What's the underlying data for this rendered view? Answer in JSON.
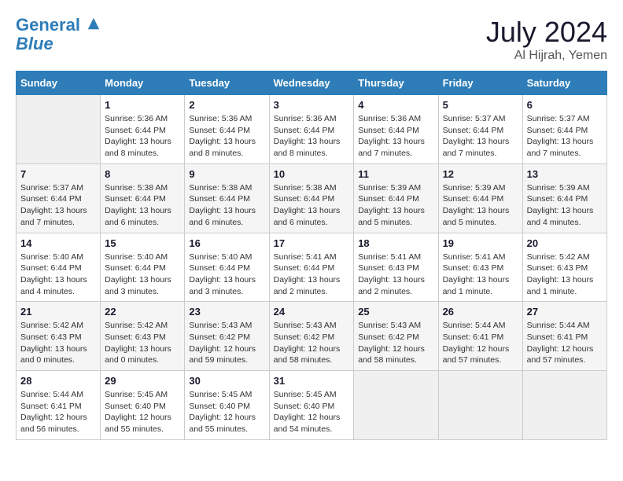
{
  "header": {
    "logo_line1": "General",
    "logo_line2": "Blue",
    "month": "July 2024",
    "location": "Al Hijrah, Yemen"
  },
  "days_of_week": [
    "Sunday",
    "Monday",
    "Tuesday",
    "Wednesday",
    "Thursday",
    "Friday",
    "Saturday"
  ],
  "weeks": [
    [
      {
        "day": "",
        "sunrise": "",
        "sunset": "",
        "daylight": ""
      },
      {
        "day": "1",
        "sunrise": "Sunrise: 5:36 AM",
        "sunset": "Sunset: 6:44 PM",
        "daylight": "Daylight: 13 hours and 8 minutes."
      },
      {
        "day": "2",
        "sunrise": "Sunrise: 5:36 AM",
        "sunset": "Sunset: 6:44 PM",
        "daylight": "Daylight: 13 hours and 8 minutes."
      },
      {
        "day": "3",
        "sunrise": "Sunrise: 5:36 AM",
        "sunset": "Sunset: 6:44 PM",
        "daylight": "Daylight: 13 hours and 8 minutes."
      },
      {
        "day": "4",
        "sunrise": "Sunrise: 5:36 AM",
        "sunset": "Sunset: 6:44 PM",
        "daylight": "Daylight: 13 hours and 7 minutes."
      },
      {
        "day": "5",
        "sunrise": "Sunrise: 5:37 AM",
        "sunset": "Sunset: 6:44 PM",
        "daylight": "Daylight: 13 hours and 7 minutes."
      },
      {
        "day": "6",
        "sunrise": "Sunrise: 5:37 AM",
        "sunset": "Sunset: 6:44 PM",
        "daylight": "Daylight: 13 hours and 7 minutes."
      }
    ],
    [
      {
        "day": "7",
        "sunrise": "Sunrise: 5:37 AM",
        "sunset": "Sunset: 6:44 PM",
        "daylight": "Daylight: 13 hours and 7 minutes."
      },
      {
        "day": "8",
        "sunrise": "Sunrise: 5:38 AM",
        "sunset": "Sunset: 6:44 PM",
        "daylight": "Daylight: 13 hours and 6 minutes."
      },
      {
        "day": "9",
        "sunrise": "Sunrise: 5:38 AM",
        "sunset": "Sunset: 6:44 PM",
        "daylight": "Daylight: 13 hours and 6 minutes."
      },
      {
        "day": "10",
        "sunrise": "Sunrise: 5:38 AM",
        "sunset": "Sunset: 6:44 PM",
        "daylight": "Daylight: 13 hours and 6 minutes."
      },
      {
        "day": "11",
        "sunrise": "Sunrise: 5:39 AM",
        "sunset": "Sunset: 6:44 PM",
        "daylight": "Daylight: 13 hours and 5 minutes."
      },
      {
        "day": "12",
        "sunrise": "Sunrise: 5:39 AM",
        "sunset": "Sunset: 6:44 PM",
        "daylight": "Daylight: 13 hours and 5 minutes."
      },
      {
        "day": "13",
        "sunrise": "Sunrise: 5:39 AM",
        "sunset": "Sunset: 6:44 PM",
        "daylight": "Daylight: 13 hours and 4 minutes."
      }
    ],
    [
      {
        "day": "14",
        "sunrise": "Sunrise: 5:40 AM",
        "sunset": "Sunset: 6:44 PM",
        "daylight": "Daylight: 13 hours and 4 minutes."
      },
      {
        "day": "15",
        "sunrise": "Sunrise: 5:40 AM",
        "sunset": "Sunset: 6:44 PM",
        "daylight": "Daylight: 13 hours and 3 minutes."
      },
      {
        "day": "16",
        "sunrise": "Sunrise: 5:40 AM",
        "sunset": "Sunset: 6:44 PM",
        "daylight": "Daylight: 13 hours and 3 minutes."
      },
      {
        "day": "17",
        "sunrise": "Sunrise: 5:41 AM",
        "sunset": "Sunset: 6:44 PM",
        "daylight": "Daylight: 13 hours and 2 minutes."
      },
      {
        "day": "18",
        "sunrise": "Sunrise: 5:41 AM",
        "sunset": "Sunset: 6:43 PM",
        "daylight": "Daylight: 13 hours and 2 minutes."
      },
      {
        "day": "19",
        "sunrise": "Sunrise: 5:41 AM",
        "sunset": "Sunset: 6:43 PM",
        "daylight": "Daylight: 13 hours and 1 minute."
      },
      {
        "day": "20",
        "sunrise": "Sunrise: 5:42 AM",
        "sunset": "Sunset: 6:43 PM",
        "daylight": "Daylight: 13 hours and 1 minute."
      }
    ],
    [
      {
        "day": "21",
        "sunrise": "Sunrise: 5:42 AM",
        "sunset": "Sunset: 6:43 PM",
        "daylight": "Daylight: 13 hours and 0 minutes."
      },
      {
        "day": "22",
        "sunrise": "Sunrise: 5:42 AM",
        "sunset": "Sunset: 6:43 PM",
        "daylight": "Daylight: 13 hours and 0 minutes."
      },
      {
        "day": "23",
        "sunrise": "Sunrise: 5:43 AM",
        "sunset": "Sunset: 6:42 PM",
        "daylight": "Daylight: 12 hours and 59 minutes."
      },
      {
        "day": "24",
        "sunrise": "Sunrise: 5:43 AM",
        "sunset": "Sunset: 6:42 PM",
        "daylight": "Daylight: 12 hours and 58 minutes."
      },
      {
        "day": "25",
        "sunrise": "Sunrise: 5:43 AM",
        "sunset": "Sunset: 6:42 PM",
        "daylight": "Daylight: 12 hours and 58 minutes."
      },
      {
        "day": "26",
        "sunrise": "Sunrise: 5:44 AM",
        "sunset": "Sunset: 6:41 PM",
        "daylight": "Daylight: 12 hours and 57 minutes."
      },
      {
        "day": "27",
        "sunrise": "Sunrise: 5:44 AM",
        "sunset": "Sunset: 6:41 PM",
        "daylight": "Daylight: 12 hours and 57 minutes."
      }
    ],
    [
      {
        "day": "28",
        "sunrise": "Sunrise: 5:44 AM",
        "sunset": "Sunset: 6:41 PM",
        "daylight": "Daylight: 12 hours and 56 minutes."
      },
      {
        "day": "29",
        "sunrise": "Sunrise: 5:45 AM",
        "sunset": "Sunset: 6:40 PM",
        "daylight": "Daylight: 12 hours and 55 minutes."
      },
      {
        "day": "30",
        "sunrise": "Sunrise: 5:45 AM",
        "sunset": "Sunset: 6:40 PM",
        "daylight": "Daylight: 12 hours and 55 minutes."
      },
      {
        "day": "31",
        "sunrise": "Sunrise: 5:45 AM",
        "sunset": "Sunset: 6:40 PM",
        "daylight": "Daylight: 12 hours and 54 minutes."
      },
      {
        "day": "",
        "sunrise": "",
        "sunset": "",
        "daylight": ""
      },
      {
        "day": "",
        "sunrise": "",
        "sunset": "",
        "daylight": ""
      },
      {
        "day": "",
        "sunrise": "",
        "sunset": "",
        "daylight": ""
      }
    ]
  ]
}
